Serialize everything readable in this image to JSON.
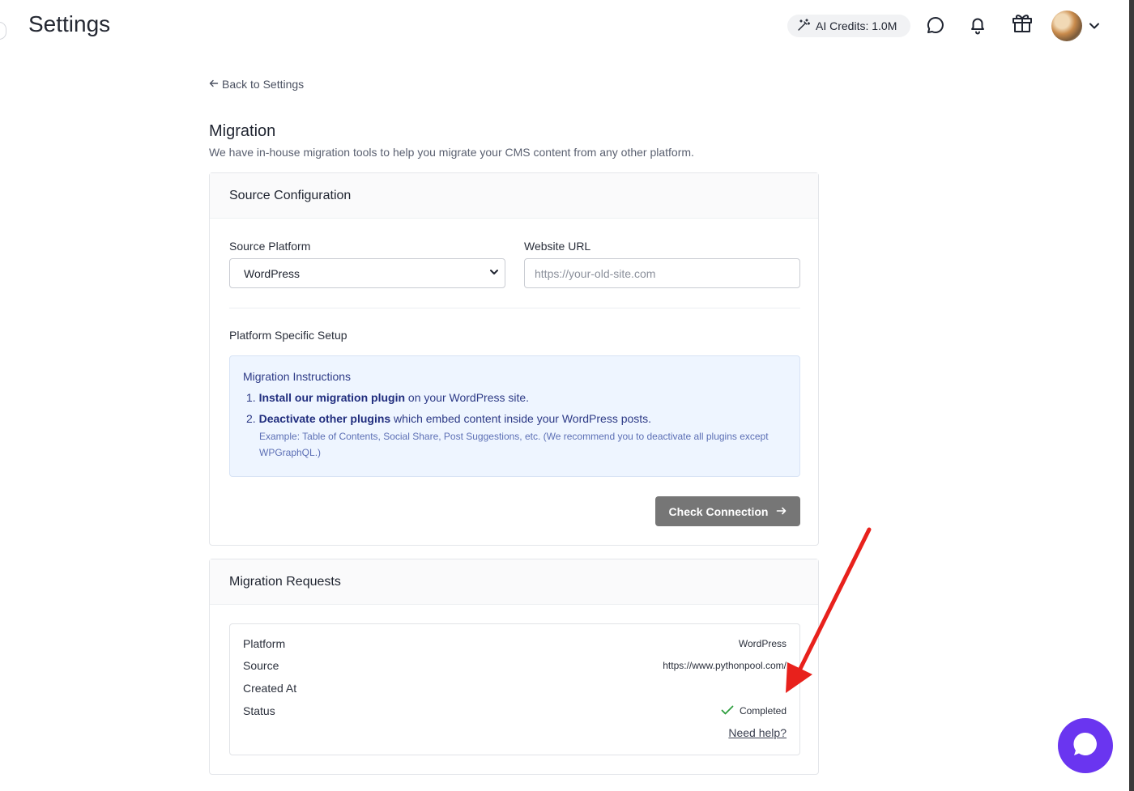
{
  "header": {
    "title": "Settings",
    "credits_label": "AI Credits: 1.0M"
  },
  "nav": {
    "back_label": "Back to Settings"
  },
  "page": {
    "title": "Migration",
    "description": "We have in-house migration tools to help you migrate your CMS content from any other platform."
  },
  "source_config": {
    "heading": "Source Configuration",
    "platform_label": "Source Platform",
    "platform_value": "WordPress",
    "url_label": "Website URL",
    "url_placeholder": "https://your-old-site.com",
    "setup_heading": "Platform Specific Setup",
    "instructions": {
      "title": "Migration Instructions",
      "item1_num": "1.",
      "item1_bold": "Install our migration plugin",
      "item1_rest": " on your WordPress site.",
      "item2_num": "2.",
      "item2_bold": "Deactivate other plugins",
      "item2_rest": " which embed content inside your WordPress posts.",
      "note": "Example: Table of Contents, Social Share, Post Suggestions, etc. (We recommend you to deactivate all plugins except WPGraphQL.)"
    },
    "check_button": "Check Connection"
  },
  "requests": {
    "heading": "Migration Requests",
    "rows": [
      {
        "key": "Platform",
        "value": "WordPress"
      },
      {
        "key": "Source",
        "value": "https://www.pythonpool.com/"
      },
      {
        "key": "Created At",
        "value": ""
      },
      {
        "key": "Status",
        "value": "Completed"
      }
    ],
    "help_link": "Need help?"
  },
  "colors": {
    "accent_purple": "#6a35f0",
    "annotation_red": "#e8211c",
    "status_green": "#2e9e3e",
    "button_gray": "#767676"
  }
}
